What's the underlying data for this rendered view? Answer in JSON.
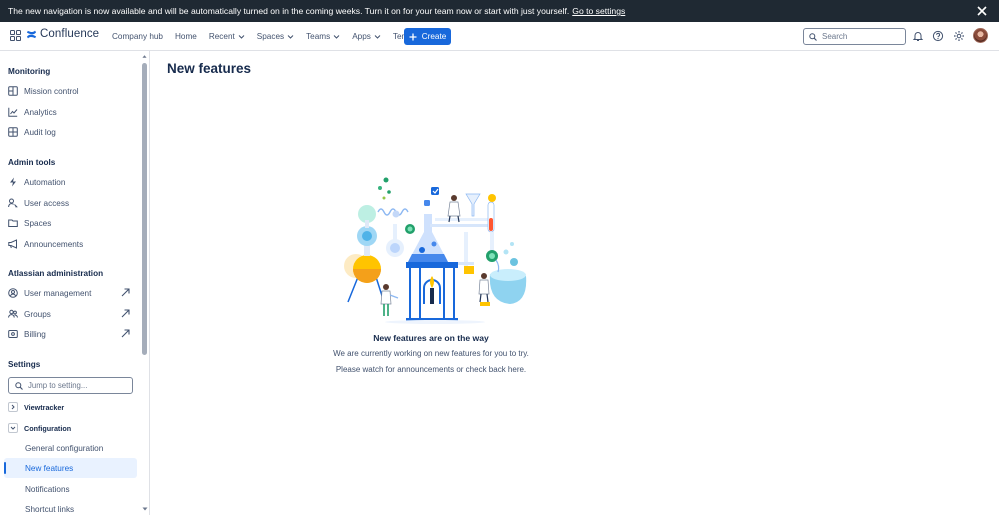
{
  "banner": {
    "message": "The new navigation is now available and will be automatically turned on in the coming weeks. Turn it on for your team now or start with just yourself.",
    "link": "Go to settings"
  },
  "topnav": {
    "brand": "Confluence",
    "items": [
      {
        "label": "Company hub",
        "dropdown": false
      },
      {
        "label": "Home",
        "dropdown": false
      },
      {
        "label": "Recent",
        "dropdown": true
      },
      {
        "label": "Spaces",
        "dropdown": true
      },
      {
        "label": "Teams",
        "dropdown": true
      },
      {
        "label": "Apps",
        "dropdown": true
      },
      {
        "label": "Templates",
        "dropdown": false
      }
    ],
    "create_label": "Create",
    "search_placeholder": "Search"
  },
  "sidebar": {
    "monitoring": {
      "title": "Monitoring",
      "items": [
        "Mission control",
        "Analytics",
        "Audit log"
      ]
    },
    "admin_tools": {
      "title": "Admin tools",
      "items": [
        "Automation",
        "User access",
        "Spaces",
        "Announcements"
      ]
    },
    "atlassian_admin": {
      "title": "Atlassian administration",
      "items": [
        "User management",
        "Groups",
        "Billing"
      ]
    },
    "settings": {
      "title": "Settings",
      "jump_placeholder": "Jump to setting...",
      "viewtracker": "Viewtracker",
      "configuration": "Configuration",
      "sub_items": [
        "General configuration",
        "New features",
        "Notifications",
        "Shortcut links"
      ]
    }
  },
  "main": {
    "title": "New features",
    "empty_title": "New features are on the way",
    "empty_line1": "We are currently working on new features for you to try.",
    "empty_line2": "Please watch for announcements or check back here."
  },
  "colors": {
    "brand_blue": "#1868db",
    "banner_bg": "#1f2933",
    "active_bg": "#e9f2ff"
  }
}
